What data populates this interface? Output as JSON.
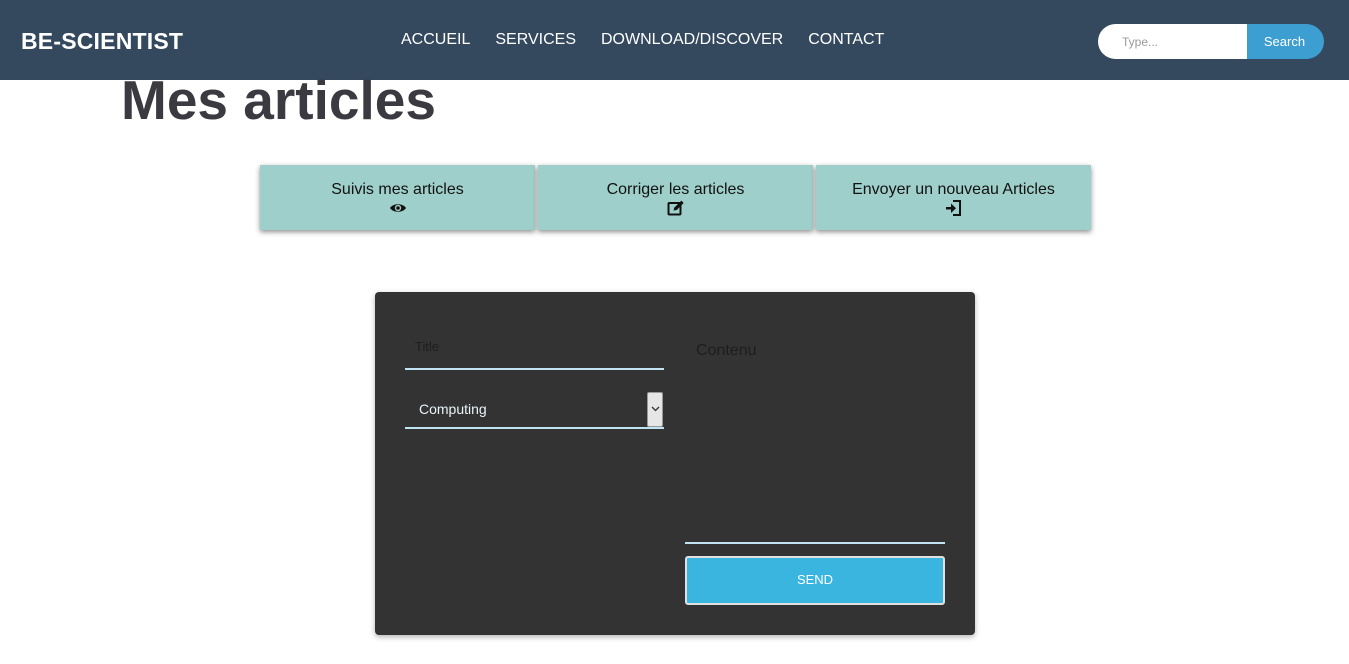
{
  "header": {
    "brand": "BE-SCIENTIST",
    "nav": [
      "ACCUEIL",
      "SERVICES",
      "DOWNLOAD/DISCOVER",
      "CONTACT"
    ],
    "search": {
      "placeholder": "Type...",
      "button_label": "Search"
    }
  },
  "main": {
    "title": "Mes articles",
    "tabs": [
      {
        "label": "Suivis mes articles",
        "icon": "eye-icon"
      },
      {
        "label": "Corriger les articles",
        "icon": "edit-icon"
      },
      {
        "label": "Envoyer un nouveau Articles",
        "icon": "sign-in-icon"
      }
    ],
    "form": {
      "title_placeholder": "Title",
      "category_value": "Computing",
      "content_placeholder": "Contenu",
      "send_label": "SEND"
    }
  },
  "colors": {
    "header_bg": "#34495e",
    "search_button": "#3d9fd1",
    "tab_bg": "#9fcfca",
    "form_bg": "#333333",
    "send_button": "#39b5e0"
  }
}
